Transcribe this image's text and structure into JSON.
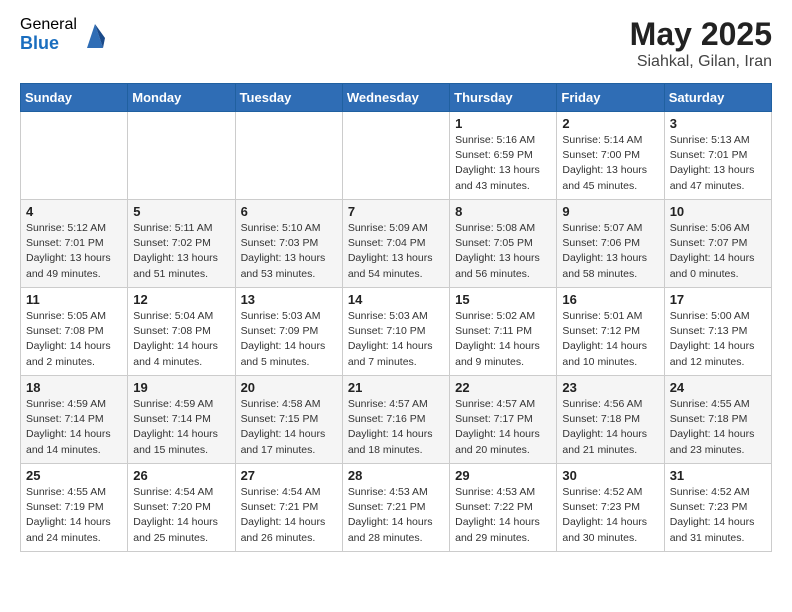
{
  "header": {
    "logo_general": "General",
    "logo_blue": "Blue",
    "title": "May 2025",
    "location": "Siahkal, Gilan, Iran"
  },
  "days_of_week": [
    "Sunday",
    "Monday",
    "Tuesday",
    "Wednesday",
    "Thursday",
    "Friday",
    "Saturday"
  ],
  "weeks": [
    [
      {
        "day": "",
        "info": ""
      },
      {
        "day": "",
        "info": ""
      },
      {
        "day": "",
        "info": ""
      },
      {
        "day": "",
        "info": ""
      },
      {
        "day": "1",
        "info": "Sunrise: 5:16 AM\nSunset: 6:59 PM\nDaylight: 13 hours\nand 43 minutes."
      },
      {
        "day": "2",
        "info": "Sunrise: 5:14 AM\nSunset: 7:00 PM\nDaylight: 13 hours\nand 45 minutes."
      },
      {
        "day": "3",
        "info": "Sunrise: 5:13 AM\nSunset: 7:01 PM\nDaylight: 13 hours\nand 47 minutes."
      }
    ],
    [
      {
        "day": "4",
        "info": "Sunrise: 5:12 AM\nSunset: 7:01 PM\nDaylight: 13 hours\nand 49 minutes."
      },
      {
        "day": "5",
        "info": "Sunrise: 5:11 AM\nSunset: 7:02 PM\nDaylight: 13 hours\nand 51 minutes."
      },
      {
        "day": "6",
        "info": "Sunrise: 5:10 AM\nSunset: 7:03 PM\nDaylight: 13 hours\nand 53 minutes."
      },
      {
        "day": "7",
        "info": "Sunrise: 5:09 AM\nSunset: 7:04 PM\nDaylight: 13 hours\nand 54 minutes."
      },
      {
        "day": "8",
        "info": "Sunrise: 5:08 AM\nSunset: 7:05 PM\nDaylight: 13 hours\nand 56 minutes."
      },
      {
        "day": "9",
        "info": "Sunrise: 5:07 AM\nSunset: 7:06 PM\nDaylight: 13 hours\nand 58 minutes."
      },
      {
        "day": "10",
        "info": "Sunrise: 5:06 AM\nSunset: 7:07 PM\nDaylight: 14 hours\nand 0 minutes."
      }
    ],
    [
      {
        "day": "11",
        "info": "Sunrise: 5:05 AM\nSunset: 7:08 PM\nDaylight: 14 hours\nand 2 minutes."
      },
      {
        "day": "12",
        "info": "Sunrise: 5:04 AM\nSunset: 7:08 PM\nDaylight: 14 hours\nand 4 minutes."
      },
      {
        "day": "13",
        "info": "Sunrise: 5:03 AM\nSunset: 7:09 PM\nDaylight: 14 hours\nand 5 minutes."
      },
      {
        "day": "14",
        "info": "Sunrise: 5:03 AM\nSunset: 7:10 PM\nDaylight: 14 hours\nand 7 minutes."
      },
      {
        "day": "15",
        "info": "Sunrise: 5:02 AM\nSunset: 7:11 PM\nDaylight: 14 hours\nand 9 minutes."
      },
      {
        "day": "16",
        "info": "Sunrise: 5:01 AM\nSunset: 7:12 PM\nDaylight: 14 hours\nand 10 minutes."
      },
      {
        "day": "17",
        "info": "Sunrise: 5:00 AM\nSunset: 7:13 PM\nDaylight: 14 hours\nand 12 minutes."
      }
    ],
    [
      {
        "day": "18",
        "info": "Sunrise: 4:59 AM\nSunset: 7:14 PM\nDaylight: 14 hours\nand 14 minutes."
      },
      {
        "day": "19",
        "info": "Sunrise: 4:59 AM\nSunset: 7:14 PM\nDaylight: 14 hours\nand 15 minutes."
      },
      {
        "day": "20",
        "info": "Sunrise: 4:58 AM\nSunset: 7:15 PM\nDaylight: 14 hours\nand 17 minutes."
      },
      {
        "day": "21",
        "info": "Sunrise: 4:57 AM\nSunset: 7:16 PM\nDaylight: 14 hours\nand 18 minutes."
      },
      {
        "day": "22",
        "info": "Sunrise: 4:57 AM\nSunset: 7:17 PM\nDaylight: 14 hours\nand 20 minutes."
      },
      {
        "day": "23",
        "info": "Sunrise: 4:56 AM\nSunset: 7:18 PM\nDaylight: 14 hours\nand 21 minutes."
      },
      {
        "day": "24",
        "info": "Sunrise: 4:55 AM\nSunset: 7:18 PM\nDaylight: 14 hours\nand 23 minutes."
      }
    ],
    [
      {
        "day": "25",
        "info": "Sunrise: 4:55 AM\nSunset: 7:19 PM\nDaylight: 14 hours\nand 24 minutes."
      },
      {
        "day": "26",
        "info": "Sunrise: 4:54 AM\nSunset: 7:20 PM\nDaylight: 14 hours\nand 25 minutes."
      },
      {
        "day": "27",
        "info": "Sunrise: 4:54 AM\nSunset: 7:21 PM\nDaylight: 14 hours\nand 26 minutes."
      },
      {
        "day": "28",
        "info": "Sunrise: 4:53 AM\nSunset: 7:21 PM\nDaylight: 14 hours\nand 28 minutes."
      },
      {
        "day": "29",
        "info": "Sunrise: 4:53 AM\nSunset: 7:22 PM\nDaylight: 14 hours\nand 29 minutes."
      },
      {
        "day": "30",
        "info": "Sunrise: 4:52 AM\nSunset: 7:23 PM\nDaylight: 14 hours\nand 30 minutes."
      },
      {
        "day": "31",
        "info": "Sunrise: 4:52 AM\nSunset: 7:23 PM\nDaylight: 14 hours\nand 31 minutes."
      }
    ]
  ]
}
